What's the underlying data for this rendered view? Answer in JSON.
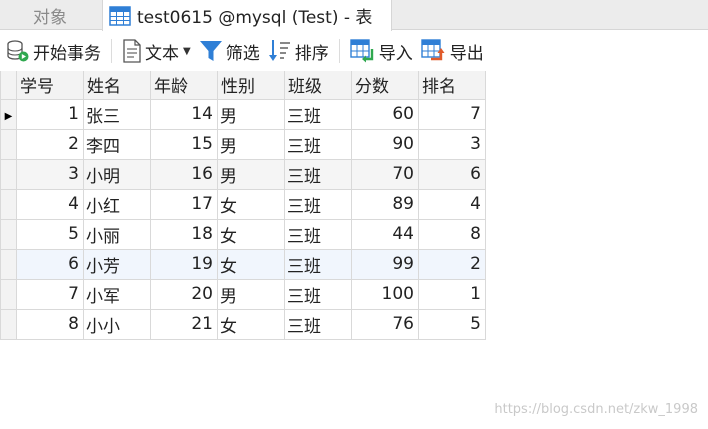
{
  "tabs": {
    "objects_label": "对象",
    "table_tab_label": "test0615 @mysql (Test) - 表"
  },
  "toolbar": {
    "begin_transaction": "开始事务",
    "text": "文本",
    "filter": "筛选",
    "sort": "排序",
    "import": "导入",
    "export": "导出"
  },
  "grid": {
    "columns": [
      "学号",
      "姓名",
      "年龄",
      "性别",
      "班级",
      "分数",
      "排名"
    ],
    "rows": [
      [
        "1",
        "张三",
        "14",
        "男",
        "三班",
        "60",
        "7"
      ],
      [
        "2",
        "李四",
        "15",
        "男",
        "三班",
        "90",
        "3"
      ],
      [
        "3",
        "小明",
        "16",
        "男",
        "三班",
        "70",
        "6"
      ],
      [
        "4",
        "小红",
        "17",
        "女",
        "三班",
        "89",
        "4"
      ],
      [
        "5",
        "小丽",
        "18",
        "女",
        "三班",
        "44",
        "8"
      ],
      [
        "6",
        "小芳",
        "19",
        "女",
        "三班",
        "99",
        "2"
      ],
      [
        "7",
        "小军",
        "20",
        "男",
        "三班",
        "100",
        "1"
      ],
      [
        "8",
        "小小",
        "21",
        "女",
        "三班",
        "76",
        "5"
      ]
    ],
    "current_row_marker": "▶"
  },
  "watermark": "https://blog.csdn.net/zkw_1998",
  "colors": {
    "accent_blue": "#2f7fd6",
    "header_bg": "#f3f3f3",
    "selected_row_bg": "#f1f6fd"
  }
}
